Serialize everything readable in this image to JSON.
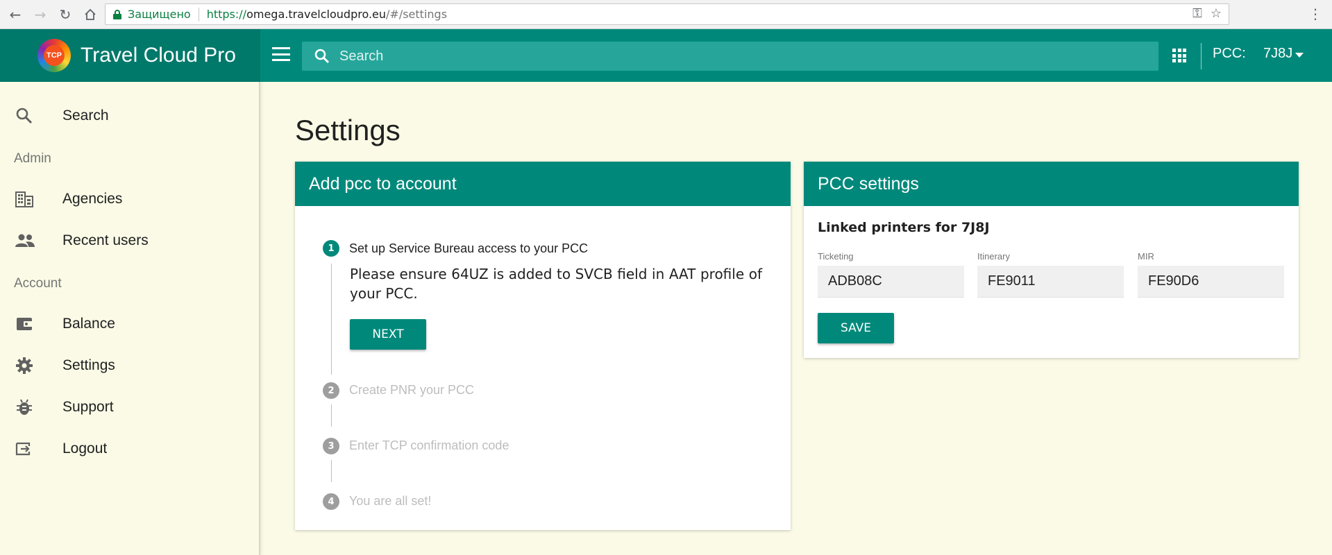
{
  "browser": {
    "secure_label": "Защищено",
    "url_scheme": "https://",
    "url_host": "omega.travelcloudpro.eu",
    "url_path": "/#/settings"
  },
  "header": {
    "brand_name": "Travel Cloud Pro",
    "logo_text": "TCP",
    "search_placeholder": "Search",
    "pcc_label": "PCC:",
    "pcc_value": "7J8J"
  },
  "sidebar": {
    "items": [
      {
        "label": "Search",
        "icon": "search-icon"
      },
      {
        "label": "Agencies",
        "icon": "building-icon"
      },
      {
        "label": "Recent users",
        "icon": "people-icon"
      },
      {
        "label": "Balance",
        "icon": "wallet-icon"
      },
      {
        "label": "Settings",
        "icon": "gear-icon"
      },
      {
        "label": "Support",
        "icon": "bug-icon"
      },
      {
        "label": "Logout",
        "icon": "logout-icon"
      }
    ],
    "sections": {
      "admin": "Admin",
      "account": "Account"
    }
  },
  "main": {
    "title": "Settings",
    "add_pcc_card": {
      "title": "Add pcc to account",
      "steps": [
        {
          "number": "1",
          "title": "Set up Service Bureau access to your PCC",
          "state": "active"
        },
        {
          "number": "2",
          "title": "Create PNR your PCC",
          "state": "pending"
        },
        {
          "number": "3",
          "title": "Enter TCP confirmation code",
          "state": "pending"
        },
        {
          "number": "4",
          "title": "You are all set!",
          "state": "pending"
        }
      ],
      "step1_body": "Please ensure 64UZ is added to SVCB field in AAT profile of your PCC.",
      "next_label": "NEXT"
    },
    "pcc_settings_card": {
      "title": "PCC settings",
      "linked_title": "Linked printers for 7J8J",
      "fields": [
        {
          "label": "Ticketing",
          "value": "ADB08C"
        },
        {
          "label": "Itinerary",
          "value": "FE9011"
        },
        {
          "label": "MIR",
          "value": "FE90D6"
        }
      ],
      "save_label": "SAVE"
    }
  },
  "colors": {
    "primary": "#00897b",
    "primary_dark": "#00796b",
    "background": "#fafae6"
  }
}
